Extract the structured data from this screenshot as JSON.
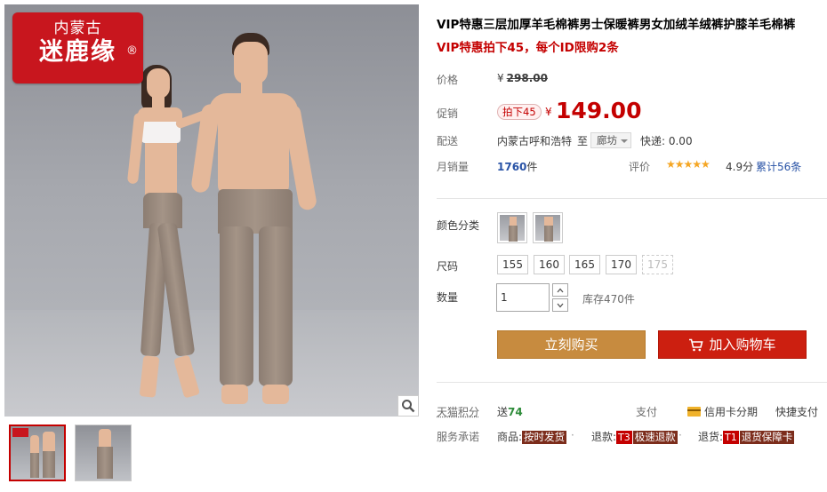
{
  "brand_logo": {
    "line1": "内蒙古",
    "line2": "迷鹿缘",
    "reg": "®"
  },
  "product": {
    "title": "VIP特惠三层加厚羊毛棉裤男士保暖裤男女加绒羊绒裤护膝羊毛棉裤",
    "subtitle": "VIP特惠拍下45，每个ID限购2条"
  },
  "price": {
    "label": "价格",
    "currency": "¥",
    "original": "298.00",
    "promo_label": "促销",
    "promo_tag": "拍下45",
    "current": "149.00"
  },
  "shipping": {
    "label": "配送",
    "from": "内蒙古呼和浩特",
    "to_label": "至",
    "destination": "廊坊",
    "fee": "快递: 0.00"
  },
  "sales": {
    "label": "月销量",
    "count": "1760",
    "unit": "件",
    "rating_label": "评价",
    "stars": "★★★★★",
    "score": "4.9分",
    "reviews": "累计56条"
  },
  "sku": {
    "color_label": "颜色分类",
    "size_label": "尺码",
    "sizes": [
      {
        "value": "155",
        "available": true
      },
      {
        "value": "160",
        "available": true
      },
      {
        "value": "165",
        "available": true
      },
      {
        "value": "170",
        "available": true
      },
      {
        "value": "175",
        "available": false
      }
    ],
    "qty_label": "数量",
    "qty_value": "1",
    "stock": "库存470件"
  },
  "actions": {
    "buy_now": "立刻购买",
    "add_to_cart": "加入购物车"
  },
  "points": {
    "label": "天猫积分",
    "prefix": "送",
    "value": "74"
  },
  "payment": {
    "label": "支付",
    "installment": "信用卡分期",
    "quick": "快捷支付"
  },
  "promise": {
    "label": "服务承诺",
    "goods_prefix": "商品:",
    "goods_badge": "按时发货",
    "refund_prefix": "退款:",
    "refund_t": "T3",
    "refund_badge": "极速退款",
    "return_prefix": "退货:",
    "return_t": "T1",
    "return_badge": "退货保障卡"
  },
  "colors": {
    "price_red": "#c40000",
    "buy_btn": "#c78b3f",
    "cart_btn": "#cc1f10",
    "link_blue": "#2953a6"
  }
}
